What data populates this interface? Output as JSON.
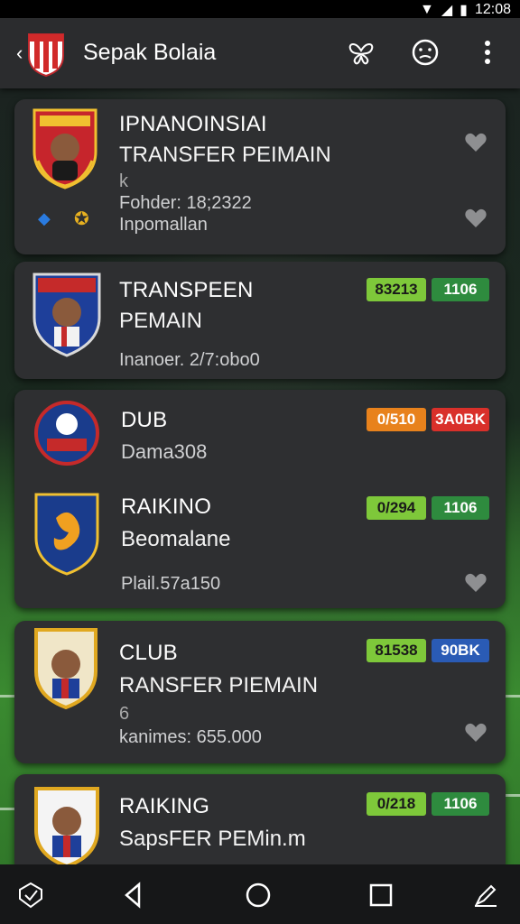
{
  "status_bar": {
    "time": "12:08"
  },
  "app_bar": {
    "title": "Sepak Bolaia",
    "back_icon": "back-arrow-icon",
    "actions": [
      "butterfly-icon",
      "face-icon",
      "more-vert-icon"
    ]
  },
  "colors": {
    "green_badge": "#7ec83a",
    "dark_green_badge": "#2e8b3e",
    "orange_badge": "#e8821c",
    "red_badge": "#d9302a",
    "blue_badge": "#2a5bb5",
    "card_bg": "#2e2f31"
  },
  "cards": [
    {
      "title": "IPNANOINSIAI",
      "subtitle": "TRANSFER PEIMAIN",
      "meta_icon": "k",
      "line1": "Fohder: 18;2322",
      "line2": "Inpomallan"
    },
    {
      "title": "TRANSPEEN",
      "subtitle": "PEMAIN",
      "line1": "Inanoer. 2/7:obo0",
      "badges": [
        "83213",
        "1106"
      ]
    },
    {
      "title": "DUB",
      "subtitle": "Dama308",
      "badges": [
        "0/510",
        "3A0BK"
      ],
      "sub_title": "RAIKINO",
      "sub_subtitle": "Beomalane",
      "sub_line": "Plail.57a150",
      "sub_badges": [
        "0/294",
        "1106"
      ]
    },
    {
      "title": "CLUB",
      "subtitle": "RANSFER PIEMAIN",
      "meta_icon": "6",
      "line1": "kanimes: 655.000",
      "badges": [
        "81538",
        "90BK"
      ]
    },
    {
      "title": "RAIKING",
      "subtitle": "SapsFER PEMin.m",
      "badges": [
        "0/218",
        "1106"
      ]
    }
  ]
}
